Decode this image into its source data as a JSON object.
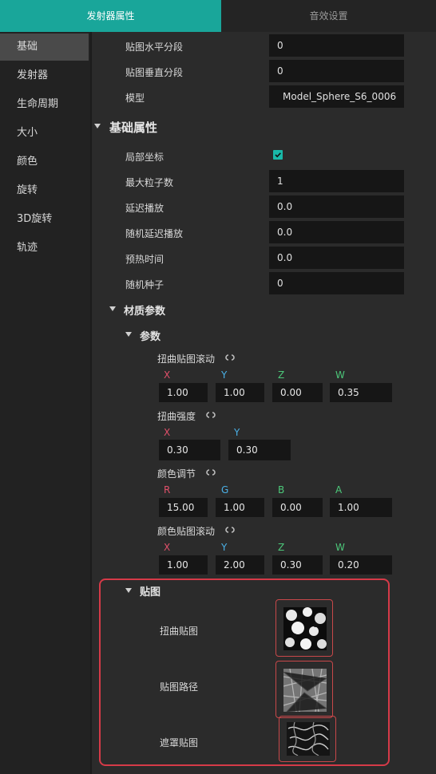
{
  "tabs": {
    "active": "发射器属性",
    "inactive": "音效设置"
  },
  "sidebar": {
    "items": [
      {
        "label": "基础",
        "active": true
      },
      {
        "label": "发射器"
      },
      {
        "label": "生命周期"
      },
      {
        "label": "大小"
      },
      {
        "label": "颜色"
      },
      {
        "label": "旋转"
      },
      {
        "label": "3D旋转"
      },
      {
        "label": "轨迹"
      }
    ]
  },
  "top_props": [
    {
      "label": "贴图水平分段",
      "value": "0"
    },
    {
      "label": "贴图垂直分段",
      "value": "0"
    },
    {
      "label": "模型",
      "value": "Model_Sphere_S6_0006"
    }
  ],
  "basic": {
    "title": "基础属性",
    "local_coords": {
      "label": "局部坐标",
      "checked": true
    },
    "props": [
      {
        "label": "最大粒子数",
        "value": "1"
      },
      {
        "label": "延迟播放",
        "value": "0.0"
      },
      {
        "label": "随机延迟播放",
        "value": "0.0"
      },
      {
        "label": "预热时间",
        "value": "0.0"
      },
      {
        "label": "随机种子",
        "value": "0"
      }
    ]
  },
  "material": {
    "title": "材质参数",
    "params_title": "参数",
    "distort_scroll": {
      "label": "扭曲贴图滚动",
      "axes": [
        "X",
        "Y",
        "Z",
        "W"
      ],
      "values": [
        "1.00",
        "1.00",
        "0.00",
        "0.35"
      ]
    },
    "distort_strength": {
      "label": "扭曲强度",
      "axes": [
        "X",
        "Y"
      ],
      "values": [
        "0.30",
        "0.30"
      ]
    },
    "color_adjust": {
      "label": "颜色调节",
      "axes": [
        "R",
        "G",
        "B",
        "A"
      ],
      "values": [
        "15.00",
        "1.00",
        "0.00",
        "1.00"
      ]
    },
    "color_scroll": {
      "label": "颜色贴图滚动",
      "axes": [
        "X",
        "Y",
        "Z",
        "W"
      ],
      "values": [
        "1.00",
        "2.00",
        "0.30",
        "0.20"
      ]
    },
    "textures": {
      "title": "贴图",
      "items": [
        {
          "label": "扭曲贴图"
        },
        {
          "label": "贴图路径"
        },
        {
          "label": "遮罩贴图"
        }
      ]
    }
  },
  "colors": {
    "accent": "#19a69a",
    "highlight_box": "#d63a48",
    "axis_x": "#e0506a",
    "axis_y": "#4ab0e6",
    "axis_z": "#4cc87a"
  }
}
